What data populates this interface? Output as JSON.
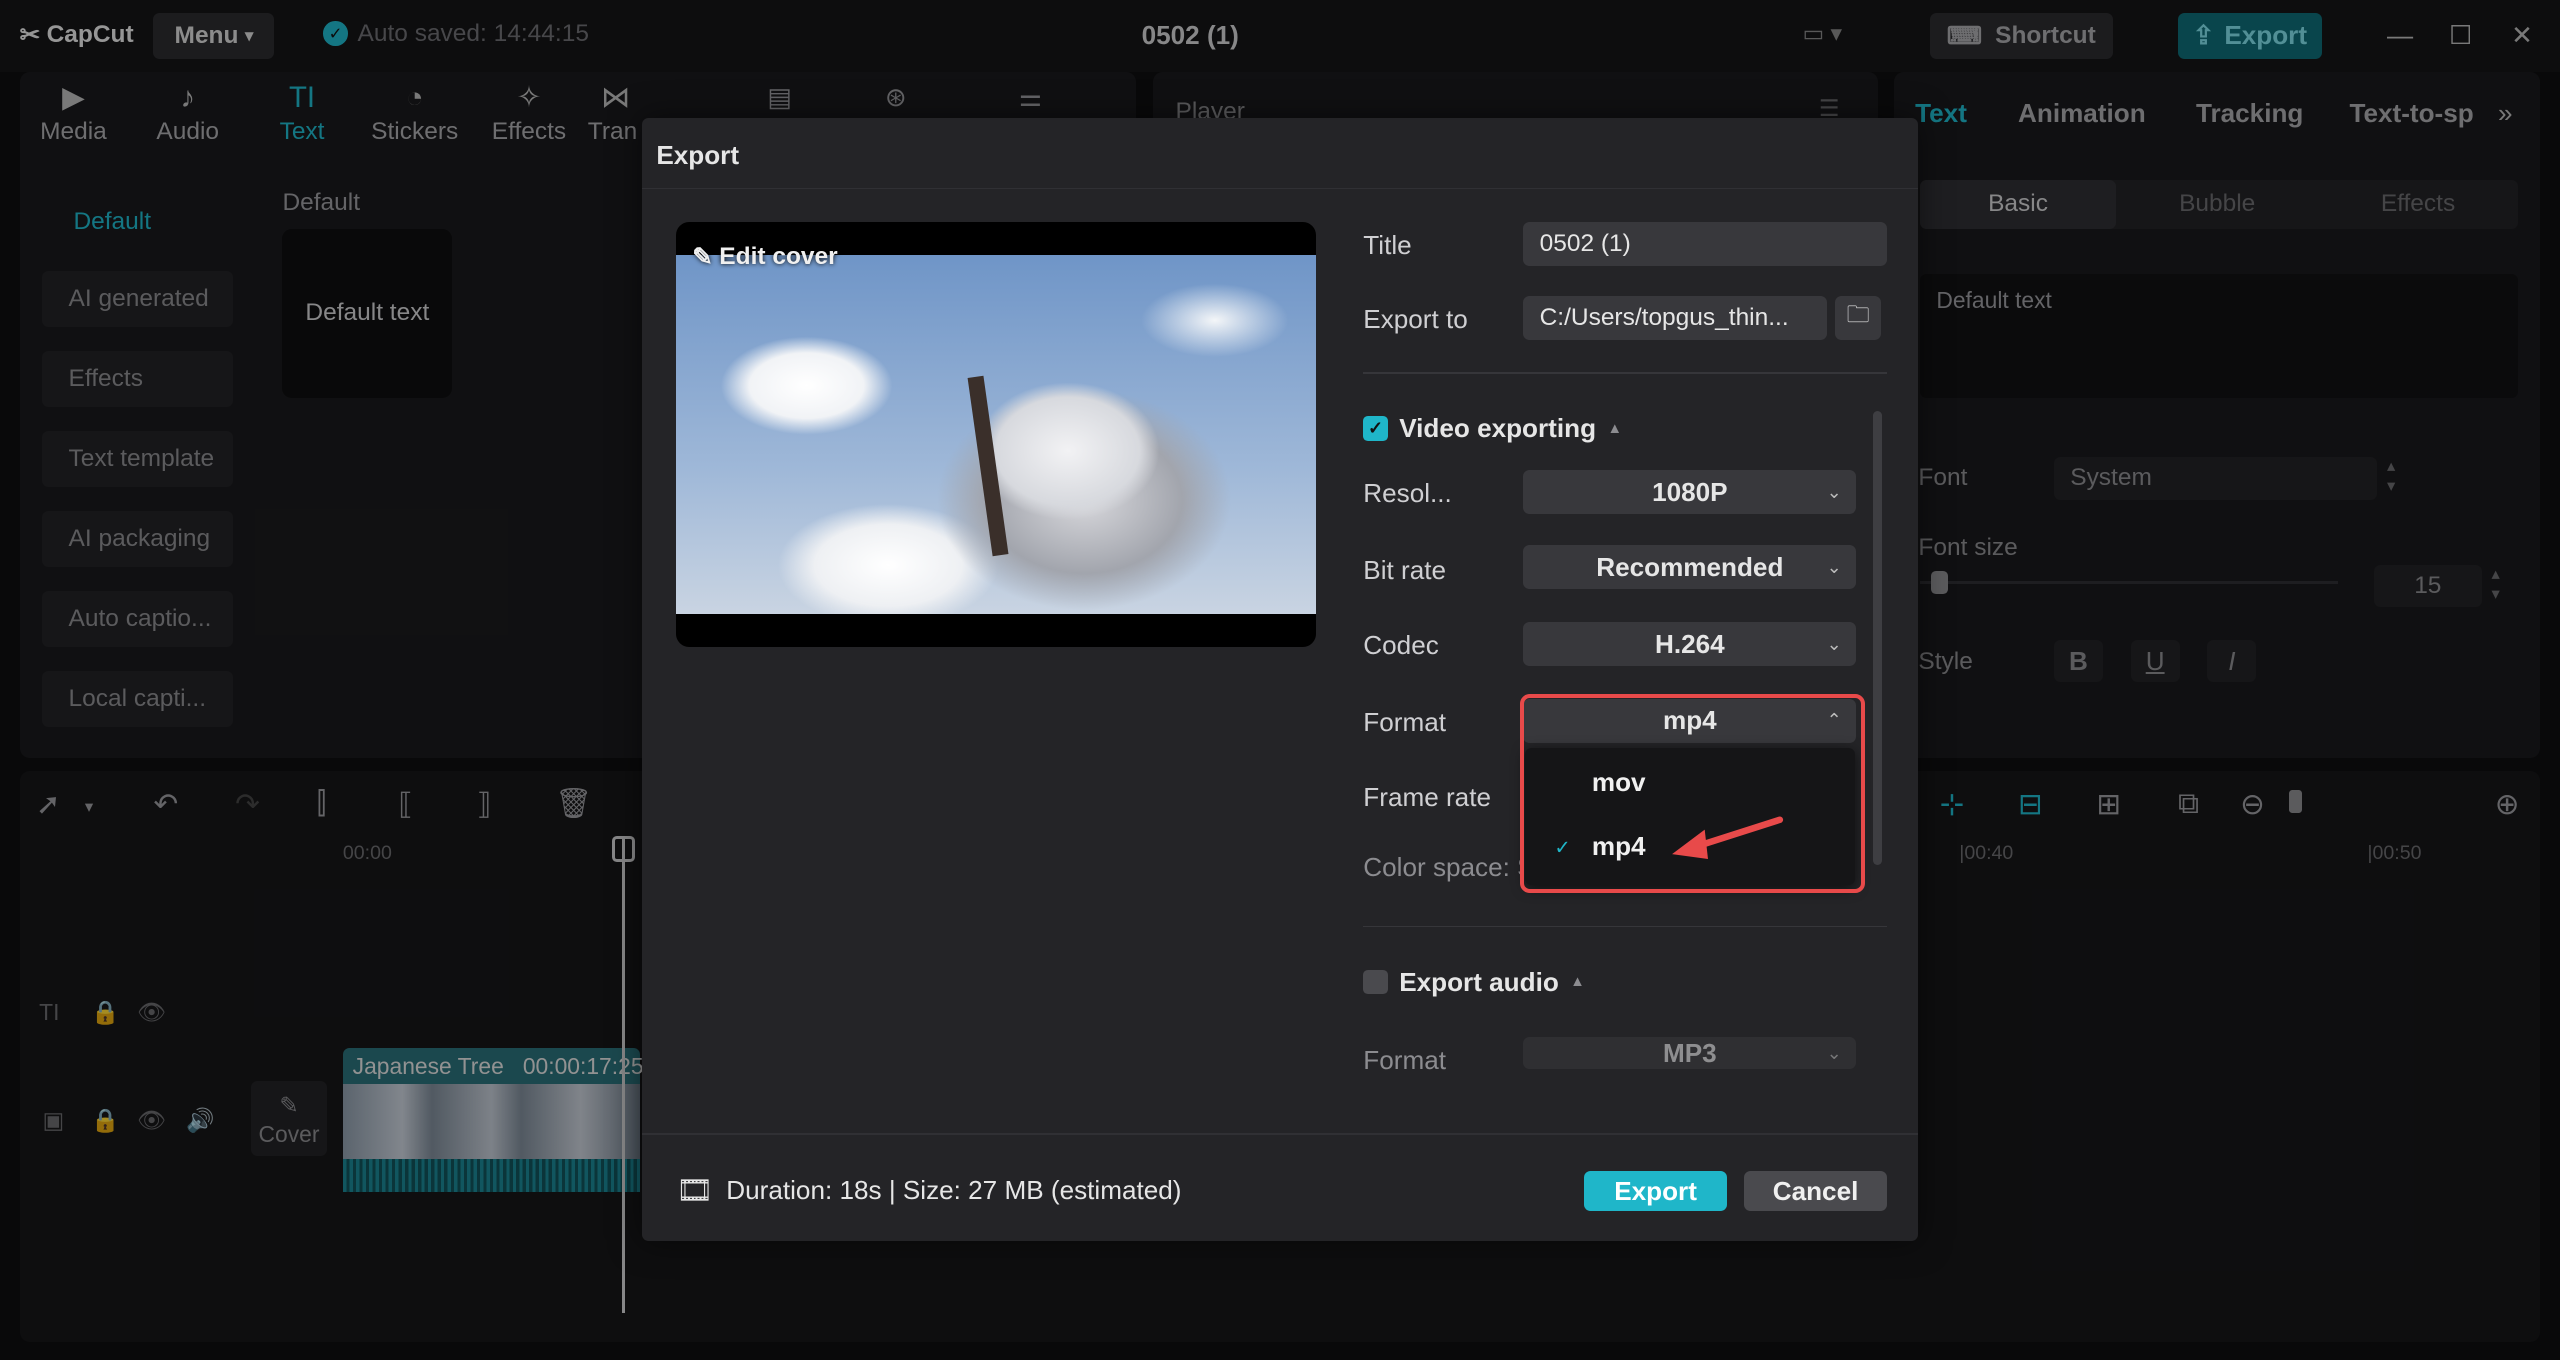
{
  "app": {
    "logo_text": "CapCut",
    "menu_label": "Menu",
    "autosave": "Auto saved: 14:44:15",
    "doc_title": "0502 (1)",
    "shortcut_label": "Shortcut",
    "export_label": "Export"
  },
  "toolbar": {
    "items": [
      {
        "label": "Media",
        "icon": "media-icon"
      },
      {
        "label": "Audio",
        "icon": "audio-icon"
      },
      {
        "label": "Text",
        "icon": "text-icon",
        "active": true
      },
      {
        "label": "Stickers",
        "icon": "stickers-icon"
      },
      {
        "label": "Effects",
        "icon": "effects-icon"
      },
      {
        "label": "Tran",
        "icon": "transitions-icon"
      }
    ]
  },
  "left_categories": [
    "Default",
    "AI generated",
    "Effects",
    "Text template",
    "AI packaging",
    "Auto captio...",
    "Local capti..."
  ],
  "text_section": {
    "heading": "Default",
    "preset": "Default text"
  },
  "player": {
    "title": "Player"
  },
  "right_panel": {
    "tabs": [
      "Text",
      "Animation",
      "Tracking",
      "Text-to-sp"
    ],
    "segments": [
      "Basic",
      "Bubble",
      "Effects"
    ],
    "textbox": "Default text",
    "font_label": "Font",
    "font_value": "System",
    "font_size_label": "Font size",
    "font_size_value": "15",
    "style_label": "Style",
    "style_buttons": [
      "B",
      "U",
      "I"
    ]
  },
  "timeline": {
    "ticks": [
      "00:00",
      "|00:40",
      "|00:50"
    ],
    "clip_name": "Japanese Tree",
    "clip_duration": "00:00:17:25",
    "cover_label": "Cover"
  },
  "export_dialog": {
    "title": "Export",
    "edit_cover": "Edit cover",
    "title_label": "Title",
    "title_value": "0502 (1)",
    "export_to_label": "Export to",
    "export_to_value": "C:/Users/topgus_thin...",
    "video_section": "Video exporting",
    "resolution_label": "Resol...",
    "resolution_value": "1080P",
    "bitrate_label": "Bit rate",
    "bitrate_value": "Recommended",
    "codec_label": "Codec",
    "codec_value": "H.264",
    "format_label": "Format",
    "format_value": "mp4",
    "framerate_label": "Frame rate",
    "colorspace_label": "Color space: S",
    "format_options": [
      {
        "label": "mov",
        "selected": false
      },
      {
        "label": "mp4",
        "selected": true
      }
    ],
    "audio_section": "Export audio",
    "audio_format_label": "Format",
    "audio_format_value": "MP3",
    "footer_info": "Duration: 18s | Size: 27 MB (estimated)",
    "export_button": "Export",
    "cancel_button": "Cancel"
  },
  "colors": {
    "accent": "#1fb6c9",
    "highlight": "#e84a4a",
    "background": "#0e0e10",
    "dialog": "#242427"
  }
}
